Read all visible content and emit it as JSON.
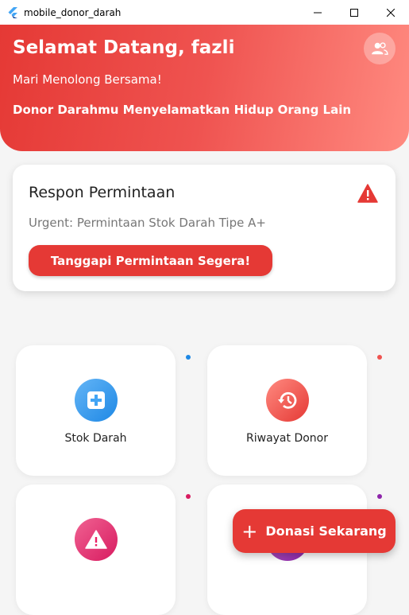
{
  "window": {
    "title": "mobile_donor_darah"
  },
  "header": {
    "greeting": "Selamat Datang, fazli",
    "subtitle": "Mari Menolong Bersama!",
    "tagline": "Donor Darahmu Menyelamatkan Hidup Orang Lain",
    "profile_icon": "people-icon"
  },
  "request_card": {
    "title": "Respon Permintaan",
    "message": "Urgent: Permintaan Stok Darah Tipe A+",
    "button_label": "Tanggapi Permintaan Segera!",
    "icon": "warning-icon"
  },
  "menu": [
    {
      "label": "Stok Darah",
      "icon": "medical-plus-icon",
      "color": "#42a5f5",
      "color2": "#1e88e5",
      "dot": "#1e88e5"
    },
    {
      "label": "Riwayat Donor",
      "icon": "history-icon",
      "color": "#ff8a80",
      "color2": "#e53935",
      "dot": "#ef5350"
    },
    {
      "label": "",
      "icon": "warning-icon",
      "color": "#f06292",
      "color2": "#d81b60",
      "dot": "#d81b60"
    },
    {
      "label": "",
      "icon": "purple-icon",
      "color": "#ab47bc",
      "color2": "#8e24aa",
      "dot": "#8e24aa"
    }
  ],
  "fab": {
    "label": "Donasi Sekarang",
    "icon": "plus-icon"
  },
  "colors": {
    "primary": "#e53935",
    "header_gradient_end": "#ff8a80"
  }
}
